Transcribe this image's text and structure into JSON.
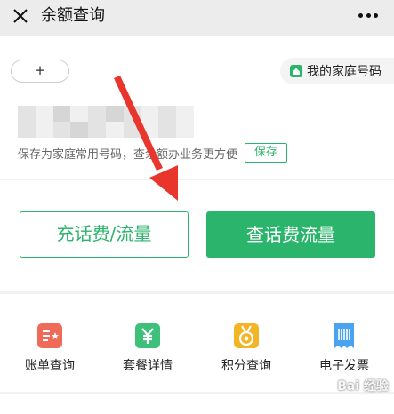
{
  "header": {
    "title": "余额查询",
    "close_icon": "close-icon",
    "more_icon": "more-dots-icon"
  },
  "account": {
    "add_label": "+",
    "home_number_label": "我的家庭号码",
    "save_hint": "保存为家庭常用号码，查余额办业务更方便",
    "save_label": "保存"
  },
  "actions": {
    "recharge_label": "充话费/流量",
    "query_label": "查话费流量"
  },
  "services": [
    {
      "label": "账单查询",
      "icon": "bill-icon",
      "color": "#f06a5a"
    },
    {
      "label": "套餐详情",
      "icon": "yuan-package-icon",
      "color": "#3cc07a"
    },
    {
      "label": "积分查询",
      "icon": "medal-icon",
      "color": "#f2b526"
    },
    {
      "label": "电子发票",
      "icon": "invoice-icon",
      "color": "#4aa3f0"
    }
  ],
  "colors": {
    "accent": "#2bb46c",
    "annotation_arrow": "#e8362d"
  },
  "watermark": "Bai 经验"
}
